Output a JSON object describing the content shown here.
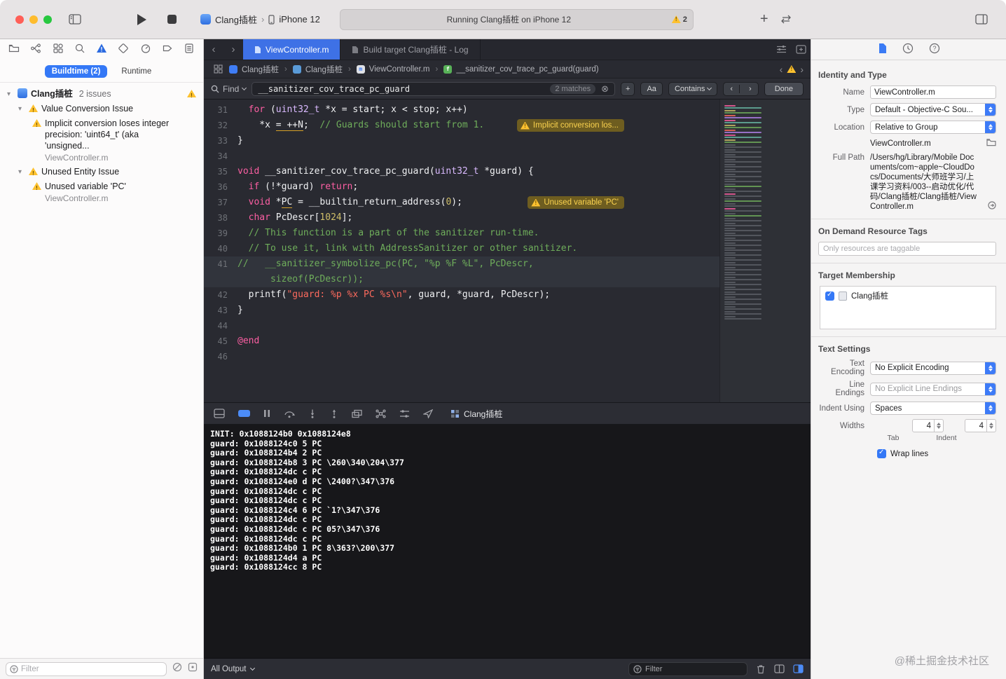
{
  "toolbar": {
    "scheme_project": "Clang插桩",
    "scheme_device": "iPhone 12",
    "activity_status": "Running Clang插桩 on iPhone 12",
    "warning_count": "2"
  },
  "navigator": {
    "buildtime_tab": "Buildtime (2)",
    "runtime_tab": "Runtime",
    "root_title": "Clang插桩",
    "root_suffix": "2 issues",
    "groups": [
      {
        "title": "Value Conversion Issue",
        "issues": [
          {
            "text": "Implicit conversion loses integer precision: 'uint64_t' (aka 'unsigned...",
            "file": "ViewController.m"
          }
        ]
      },
      {
        "title": "Unused Entity Issue",
        "issues": [
          {
            "text": "Unused variable 'PC'",
            "file": "ViewController.m"
          }
        ]
      }
    ],
    "filter_placeholder": "Filter"
  },
  "editor": {
    "tabs": [
      {
        "label": "ViewController.m",
        "active": true
      },
      {
        "label": "Build target Clang插桩 - Log",
        "active": false
      }
    ],
    "breadcrumb": [
      {
        "label": "Clang插桩",
        "icon": "project-icon"
      },
      {
        "label": "Clang插桩",
        "icon": "folder-icon"
      },
      {
        "label": "ViewController.m",
        "icon": "file-icon"
      },
      {
        "label": "__sanitizer_cov_trace_pc_guard(guard)",
        "icon": "function-icon"
      }
    ],
    "find": {
      "label": "Find",
      "query": "__sanitizer_cov_trace_pc_guard",
      "matches": "2 matches",
      "aa": "Aa",
      "mode": "Contains",
      "done": "Done"
    },
    "code": [
      {
        "n": "31",
        "segs": [
          [
            "pl",
            "  "
          ],
          [
            "kw",
            "for "
          ],
          [
            "pl",
            "("
          ],
          [
            "ty",
            "uint32_t "
          ],
          [
            "pl",
            "*x = start; x < stop; x++)"
          ]
        ]
      },
      {
        "n": "32",
        "segs": [
          [
            "pl",
            "    *x "
          ],
          [
            "ul",
            "= ++N"
          ],
          [
            "pl",
            ";  "
          ],
          [
            "co",
            "// Guards should start from 1."
          ]
        ],
        "ann": "Implicit conversion los..."
      },
      {
        "n": "33",
        "segs": [
          [
            "pl",
            "}"
          ]
        ]
      },
      {
        "n": "34",
        "segs": []
      },
      {
        "n": "35",
        "segs": [
          [
            "kw",
            "void "
          ],
          [
            "pl",
            "__sanitizer_cov_trace_pc_guard("
          ],
          [
            "ty",
            "uint32_t "
          ],
          [
            "pl",
            "*guard) {"
          ]
        ]
      },
      {
        "n": "36",
        "segs": [
          [
            "pl",
            "  "
          ],
          [
            "kw",
            "if "
          ],
          [
            "pl",
            "(!*guard) "
          ],
          [
            "kw",
            "return"
          ],
          [
            "pl",
            ";"
          ]
        ]
      },
      {
        "n": "37",
        "segs": [
          [
            "pl",
            "  "
          ],
          [
            "kw",
            "void "
          ],
          [
            "pl",
            "*"
          ],
          [
            "ul",
            "PC"
          ],
          [
            "pl",
            " = __builtin_return_address("
          ],
          [
            "nu",
            "0"
          ],
          [
            "pl",
            ");"
          ]
        ],
        "ann": "Unused variable 'PC'"
      },
      {
        "n": "38",
        "segs": [
          [
            "pl",
            "  "
          ],
          [
            "kw",
            "char "
          ],
          [
            "pl",
            "PcDescr["
          ],
          [
            "nu",
            "1024"
          ],
          [
            "pl",
            "];"
          ]
        ]
      },
      {
        "n": "39",
        "segs": [
          [
            "pl",
            "  "
          ],
          [
            "co",
            "// This function is a part of the sanitizer run-time."
          ]
        ]
      },
      {
        "n": "40",
        "segs": [
          [
            "pl",
            "  "
          ],
          [
            "co",
            "// To use it, link with AddressSanitizer or other sanitizer."
          ]
        ]
      },
      {
        "n": "41",
        "hl": true,
        "segs": [
          [
            "co",
            "//   __sanitizer_symbolize_pc(PC, \"%p %F %L\", PcDescr,"
          ]
        ]
      },
      {
        "n": "",
        "hl": true,
        "segs": [
          [
            "co",
            "      sizeof(PcDescr));"
          ]
        ]
      },
      {
        "n": "42",
        "segs": [
          [
            "pl",
            "  printf("
          ],
          [
            "st",
            "\"guard: %p %x PC %s\\n\""
          ],
          [
            "pl",
            ", guard, *guard, PcDescr);"
          ]
        ]
      },
      {
        "n": "43",
        "segs": [
          [
            "pl",
            "}"
          ]
        ]
      },
      {
        "n": "44",
        "segs": []
      },
      {
        "n": "45",
        "segs": [
          [
            "kw",
            "@end"
          ]
        ]
      },
      {
        "n": "46",
        "segs": []
      }
    ]
  },
  "debug": {
    "process": "Clang插桩",
    "all_output": "All Output",
    "filter_placeholder": "Filter",
    "console": [
      "INIT: 0x1088124b0 0x1088124e8",
      "guard: 0x1088124c0 5 PC",
      "guard: 0x1088124b4 2 PC",
      "guard: 0x1088124b8 3 PC \\260\\340\\204\\377",
      "guard: 0x1088124dc c PC",
      "guard: 0x1088124e0 d PC \\2400?\\347\\376",
      "guard: 0x1088124dc c PC",
      "guard: 0x1088124dc c PC",
      "guard: 0x1088124c4 6 PC `1?\\347\\376",
      "guard: 0x1088124dc c PC",
      "guard: 0x1088124dc c PC 05?\\347\\376",
      "guard: 0x1088124dc c PC",
      "guard: 0x1088124b0 1 PC 8\\363?\\200\\377",
      "guard: 0x1088124d4 a PC",
      "guard: 0x1088124cc 8 PC"
    ]
  },
  "inspector": {
    "headers": {
      "identity": "Identity and Type",
      "odr": "On Demand Resource Tags",
      "target": "Target Membership",
      "text": "Text Settings"
    },
    "labels": {
      "name": "Name",
      "type": "Type",
      "location": "Location",
      "full_path": "Full Path",
      "encoding": "Text Encoding",
      "endings": "Line Endings",
      "indent": "Indent Using",
      "widths": "Widths",
      "tab": "Tab",
      "indent_col": "Indent"
    },
    "name_value": "ViewController.m",
    "type_value": "Default - Objective-C Sou...",
    "location_value": "Relative to Group",
    "file_name": "ViewController.m",
    "full_path_value": "/Users/hg/Library/Mobile Documents/com~apple~CloudDocs/Documents/大师班学习/上课学习资料/003--启动优化/代码/Clang插桩/Clang插桩/ViewController.m",
    "odr_placeholder": "Only resources are taggable",
    "target_name": "Clang插桩",
    "encoding_value": "No Explicit Encoding",
    "endings_value": "No Explicit Line Endings",
    "indent_value": "Spaces",
    "tab_width": "4",
    "indent_width": "4",
    "wrap_label": "Wrap lines"
  },
  "watermark": "@稀土掘金技术社区"
}
